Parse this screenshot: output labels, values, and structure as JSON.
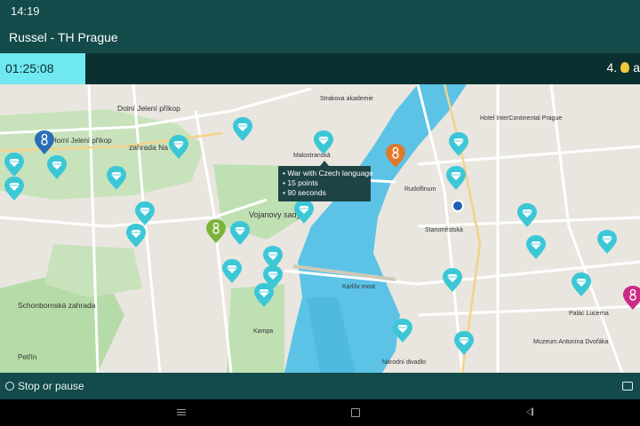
{
  "status_bar": {
    "time": "14:19"
  },
  "app_bar": {
    "title": "Russel - TH Prague"
  },
  "timer": {
    "value": "01:25:08"
  },
  "target": {
    "prefix": "4.",
    "text": "a"
  },
  "tooltip": {
    "lines": [
      "• War with Czech language",
      "• 15 points",
      "• 90 seconds"
    ]
  },
  "bottom_bar": {
    "stop_label": "Stop or pause"
  },
  "map": {
    "labels": {
      "dolni": "Dolní Jelení příkop",
      "horni": "Horní Jelení příkop",
      "zahrada": "zahrada Na V",
      "vojanovy": "Vojanovy sady",
      "schonborn": "Schonbornská zahrada",
      "staromestska": "Staroměstská",
      "palac": "Palác Lucerna",
      "dvorak": "Muzeum Antonína Dvořáka",
      "petrin": "Petřín",
      "strakova": "Strakova akademie",
      "intercontinental": "Hotel InterContinental Prague",
      "malostranska": "Malostranská",
      "rudolfinum": "Rudolfinum",
      "karluv": "Karlův most",
      "kampa": "Kampa",
      "narodni": "Národní divadlo"
    },
    "colors": {
      "water": "#5cc3e6",
      "park": "#bfe0b3",
      "land": "#e9e6df",
      "pin_cyan": "#3cc7d7",
      "pin_orange": "#e07a2a",
      "pin_green": "#7bb43a",
      "pin_blue": "#2a6fb6",
      "pin_magenta": "#cc2a86"
    }
  }
}
